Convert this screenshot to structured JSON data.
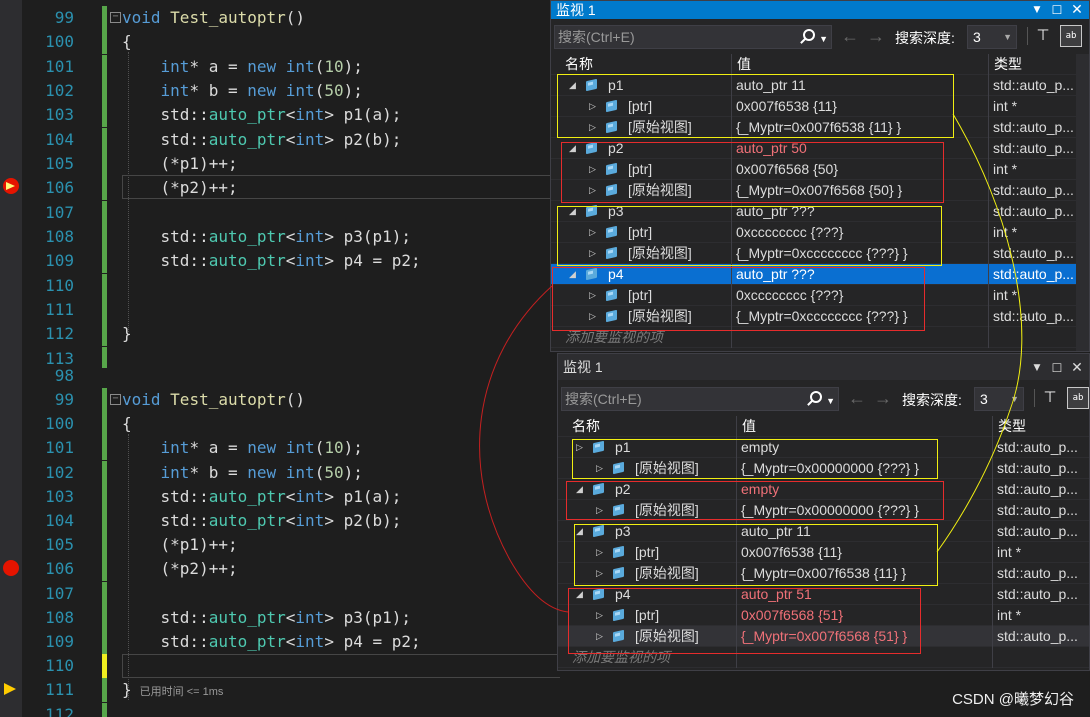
{
  "editor_top": {
    "lines": [
      {
        "n": "99",
        "html": "<span class=\"kw\">void</span> <span class=\"fn\">Test_autoptr</span>()"
      },
      {
        "n": "100",
        "html": "{"
      },
      {
        "n": "101",
        "html": "    <span class=\"kw\">int</span>* a = <span class=\"kw\">new</span> <span class=\"kw\">int</span>(<span class=\"num\">10</span>);"
      },
      {
        "n": "102",
        "html": "    <span class=\"kw\">int</span>* b = <span class=\"kw\">new</span> <span class=\"kw\">int</span>(<span class=\"num\">50</span>);"
      },
      {
        "n": "103",
        "html": "    std::<span class=\"ty\">auto_ptr</span>&lt;<span class=\"kw\">int</span>&gt; p1(a);"
      },
      {
        "n": "104",
        "html": "    std::<span class=\"ty\">auto_ptr</span>&lt;<span class=\"kw\">int</span>&gt; p2(b);"
      },
      {
        "n": "105",
        "html": "    (*p1)++;"
      },
      {
        "n": "106",
        "html": "    (*p2)++;"
      },
      {
        "n": "107",
        "html": ""
      },
      {
        "n": "108",
        "html": "    std::<span class=\"ty\">auto_ptr</span>&lt;<span class=\"kw\">int</span>&gt; p3(p1);"
      },
      {
        "n": "109",
        "html": "    std::<span class=\"ty\">auto_ptr</span>&lt;<span class=\"kw\">int</span>&gt; p4 = p2;"
      },
      {
        "n": "110",
        "html": ""
      },
      {
        "n": "111",
        "html": ""
      },
      {
        "n": "112",
        "html": "}"
      },
      {
        "n": "113",
        "html": ""
      }
    ]
  },
  "editor_bottom": {
    "first_line": "98",
    "last_line": "112",
    "lines": [
      {
        "n": "99",
        "html": "<span class=\"kw\">void</span> <span class=\"fn\">Test_autoptr</span>()"
      },
      {
        "n": "100",
        "html": "{"
      },
      {
        "n": "101",
        "html": "    <span class=\"kw\">int</span>* a = <span class=\"kw\">new</span> <span class=\"kw\">int</span>(<span class=\"num\">10</span>);"
      },
      {
        "n": "102",
        "html": "    <span class=\"kw\">int</span>* b = <span class=\"kw\">new</span> <span class=\"kw\">int</span>(<span class=\"num\">50</span>);"
      },
      {
        "n": "103",
        "html": "    std::<span class=\"ty\">auto_ptr</span>&lt;<span class=\"kw\">int</span>&gt; p1(a);"
      },
      {
        "n": "104",
        "html": "    std::<span class=\"ty\">auto_ptr</span>&lt;<span class=\"kw\">int</span>&gt; p2(b);"
      },
      {
        "n": "105",
        "html": "    (*p1)++;"
      },
      {
        "n": "106",
        "html": "    (*p2)++;"
      },
      {
        "n": "107",
        "html": ""
      },
      {
        "n": "108",
        "html": "    std::<span class=\"ty\">auto_ptr</span>&lt;<span class=\"kw\">int</span>&gt; p3(p1);"
      },
      {
        "n": "109",
        "html": "    std::<span class=\"ty\">auto_ptr</span>&lt;<span class=\"kw\">int</span>&gt; p4 = p2;"
      },
      {
        "n": "110",
        "html": ""
      },
      {
        "n": "111",
        "html": "}<span class=\"hint\">已用时间 &lt;= 1ms</span>"
      }
    ]
  },
  "watch_top": {
    "title": "监视 1",
    "search_placeholder": "搜索(Ctrl+E)",
    "depth_label": "搜索深度:",
    "depth_value": "3",
    "headers": {
      "name": "名称",
      "value": "值",
      "type": "类型"
    },
    "rows": [
      {
        "level": 0,
        "exp": "◢",
        "name": "p1",
        "value": "auto_ptr 11",
        "type": "std::auto_p..."
      },
      {
        "level": 1,
        "exp": "▷",
        "name": "[ptr]",
        "value": "0x007f6538 {11}",
        "type": "int *"
      },
      {
        "level": 1,
        "exp": "▷",
        "name": "[原始视图]",
        "value": "{_Myptr=0x007f6538 {11} }",
        "type": "std::auto_p..."
      },
      {
        "level": 0,
        "exp": "◢",
        "name": "p2",
        "value": "auto_ptr 50",
        "type": "std::auto_p...",
        "red": true
      },
      {
        "level": 1,
        "exp": "▷",
        "name": "[ptr]",
        "value": "0x007f6568 {50}",
        "type": "int *"
      },
      {
        "level": 1,
        "exp": "▷",
        "name": "[原始视图]",
        "value": "{_Myptr=0x007f6568 {50} }",
        "type": "std::auto_p..."
      },
      {
        "level": 0,
        "exp": "◢",
        "name": "p3",
        "value": "auto_ptr ???",
        "type": "std::auto_p..."
      },
      {
        "level": 1,
        "exp": "▷",
        "name": "[ptr]",
        "value": "0xcccccccc {???}",
        "type": "int *"
      },
      {
        "level": 1,
        "exp": "▷",
        "name": "[原始视图]",
        "value": "{_Myptr=0xcccccccc {???} }",
        "type": "std::auto_p..."
      },
      {
        "level": 0,
        "exp": "◢",
        "name": "p4",
        "value": "auto_ptr ???",
        "type": "std::auto_p...",
        "selected": true
      },
      {
        "level": 1,
        "exp": "▷",
        "name": "[ptr]",
        "value": "0xcccccccc {???}",
        "type": "int *"
      },
      {
        "level": 1,
        "exp": "▷",
        "name": "[原始视图]",
        "value": "{_Myptr=0xcccccccc {???} }",
        "type": "std::auto_p..."
      }
    ],
    "add_item": "添加要监视的项"
  },
  "watch_bottom": {
    "title": "监视 1",
    "search_placeholder": "搜索(Ctrl+E)",
    "depth_label": "搜索深度:",
    "depth_value": "3",
    "headers": {
      "name": "名称",
      "value": "值",
      "type": "类型"
    },
    "rows": [
      {
        "level": 0,
        "exp": "▷",
        "name": "p1",
        "value": "empty",
        "type": "std::auto_p..."
      },
      {
        "level": 1,
        "exp": "▷",
        "name": "[原始视图]",
        "value": "{_Myptr=0x00000000 {???} }",
        "type": "std::auto_p..."
      },
      {
        "level": 0,
        "exp": "◢",
        "name": "p2",
        "value": "empty",
        "type": "std::auto_p...",
        "red": true
      },
      {
        "level": 1,
        "exp": "▷",
        "name": "[原始视图]",
        "value": "{_Myptr=0x00000000 {???} }",
        "type": "std::auto_p..."
      },
      {
        "level": 0,
        "exp": "◢",
        "name": "p3",
        "value": "auto_ptr 11",
        "type": "std::auto_p..."
      },
      {
        "level": 1,
        "exp": "▷",
        "name": "[ptr]",
        "value": "0x007f6538 {11}",
        "type": "int *"
      },
      {
        "level": 1,
        "exp": "▷",
        "name": "[原始视图]",
        "value": "{_Myptr=0x007f6538 {11} }",
        "type": "std::auto_p..."
      },
      {
        "level": 0,
        "exp": "◢",
        "name": "p4",
        "value": "auto_ptr 51",
        "type": "std::auto_p...",
        "red": true
      },
      {
        "level": 1,
        "exp": "▷",
        "name": "[ptr]",
        "value": "0x007f6568 {51}",
        "type": "int *",
        "red": true
      },
      {
        "level": 1,
        "exp": "▷",
        "name": "[原始视图]",
        "value": "{_Myptr=0x007f6568 {51} }",
        "type": "std::auto_p...",
        "red": true,
        "alt": true
      }
    ],
    "add_item": "添加要监视的项"
  },
  "watermark": "CSDN @曦梦幻谷",
  "icons": {
    "search": "search-icon",
    "back": "back-arrow-icon",
    "forward": "forward-arrow-icon",
    "pin": "pin-icon",
    "hex": "hex-view-icon",
    "close": "close-icon",
    "dropdown": "dropdown-icon",
    "maximize": "maximize-icon",
    "breakpoint": "breakpoint-icon",
    "instruction_pointer": "instruction-pointer-icon"
  },
  "colors": {
    "title_active": "#007acc",
    "selection": "#0a6fd1",
    "changed_value": "#f07178",
    "annotation_yellow": "#f1ef12",
    "annotation_red": "#e62c2c"
  }
}
